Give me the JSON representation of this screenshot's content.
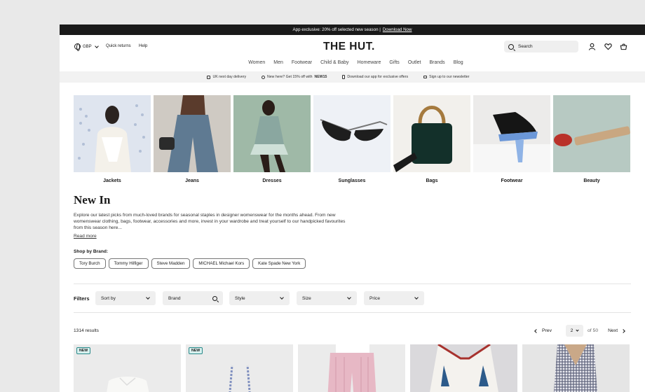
{
  "promo": {
    "text": "App exclusive: 20% off selected new season |",
    "link": "Download Now"
  },
  "header": {
    "currency": "GBP",
    "links": [
      "Quick returns",
      "Help"
    ],
    "logo": "THE HUT.",
    "search_placeholder": "Search",
    "icons": [
      "account-icon",
      "heart-icon",
      "basket-icon"
    ]
  },
  "nav": [
    "Women",
    "Men",
    "Footwear",
    "Child & Baby",
    "Homeware",
    "Gifts",
    "Outlet",
    "Brands",
    "Blog"
  ],
  "usp": [
    {
      "icon": "van-icon",
      "text": "UK next day delivery"
    },
    {
      "icon": "tag-icon",
      "text": "New here? Get 15% off with",
      "code": "NEW15"
    },
    {
      "icon": "phone-icon",
      "text": "Download our app for exclusive offers"
    },
    {
      "icon": "mail-icon",
      "text": "Sign up to our newsletter"
    }
  ],
  "categories": [
    "Jackets",
    "Jeans",
    "Dresses",
    "Sunglasses",
    "Bags",
    "Footwear",
    "Beauty"
  ],
  "page": {
    "title": "New In",
    "description": "Explore our latest picks from much-loved brands for seasonal staples in designer womenswear for the months ahead. From new womenswear clothing, bags, footwear, accessories and more, invest  in your wardrobe and treat yourself to our handpicked favourites from  this season here...",
    "read_more": "Read more",
    "shop_by_brand": "Shop by Brand:",
    "brands": [
      "Tory Burch",
      "Tommy Hilfiger",
      "Steve Madden",
      "MICHAEL Michael Kors",
      "Kate Spade New York"
    ]
  },
  "filters": {
    "label": "Filters",
    "items": [
      "Sort by",
      "Brand",
      "Style",
      "Size",
      "Price"
    ]
  },
  "results": {
    "count": "1314 results",
    "prev": "Prev",
    "current_page": "2",
    "of": "of 50",
    "next": "Next"
  },
  "products": [
    {
      "badge": "NEW"
    },
    {
      "badge": "NEW"
    },
    {
      "badge": ""
    },
    {
      "badge": ""
    },
    {
      "badge": ""
    }
  ]
}
